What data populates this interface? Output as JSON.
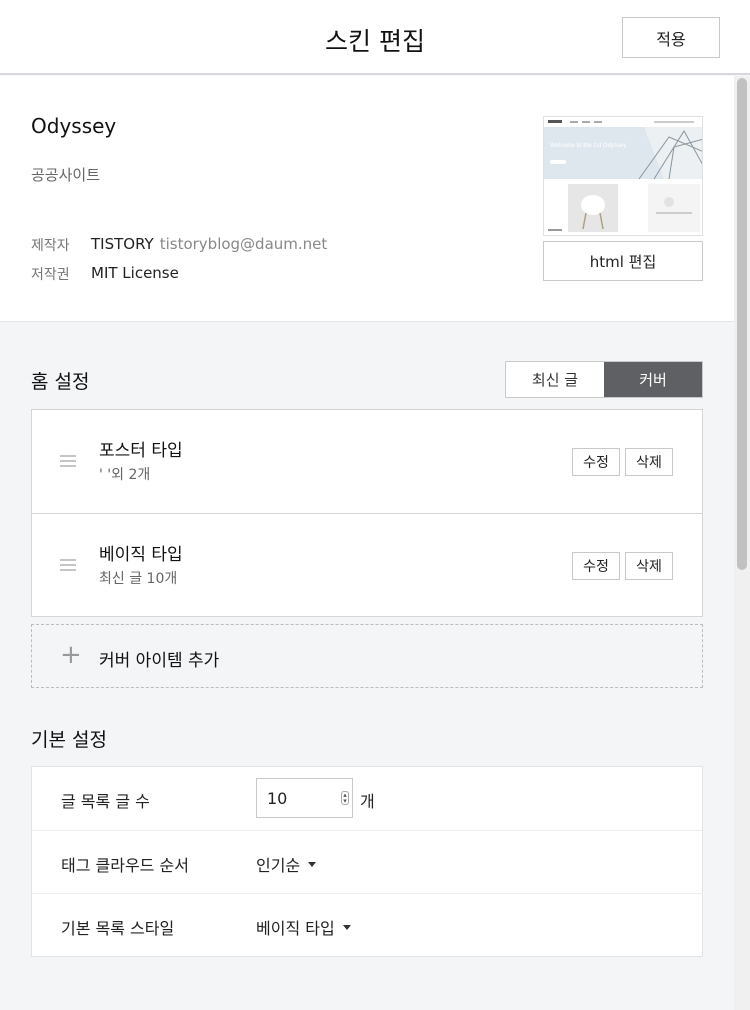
{
  "header": {
    "title": "스킨 편집",
    "apply_label": "적용"
  },
  "skin": {
    "name": "Odyssey",
    "category": "공공사이트",
    "author_label": "제작자",
    "author_name": "TISTORY",
    "author_email": "tistoryblog@daum.net",
    "license_label": "저작권",
    "license_value": "MIT License",
    "html_edit_label": "html 편집",
    "thumbnail_heading": "Welcome to the 1st Odyssey"
  },
  "home": {
    "title": "홈 설정",
    "toggle": [
      "최신 글",
      "커버"
    ],
    "selected": "커버",
    "cover_items": [
      {
        "title": "포스터 타입",
        "subtitle": "' '외 2개",
        "edit_label": "수정",
        "delete_label": "삭제"
      },
      {
        "title": "베이직 타입",
        "subtitle": "최신 글 10개",
        "edit_label": "수정",
        "delete_label": "삭제"
      }
    ],
    "add_label": "커버 아이템 추가"
  },
  "basic": {
    "title": "기본 설정",
    "post_count_label": "글 목록 글 수",
    "post_count_value": "10",
    "post_count_unit": "개",
    "tag_order_label": "태그 클라우드 순서",
    "tag_order_value": "인기순",
    "list_style_label": "기본 목록 스타일",
    "list_style_value": "베이직 타입"
  }
}
